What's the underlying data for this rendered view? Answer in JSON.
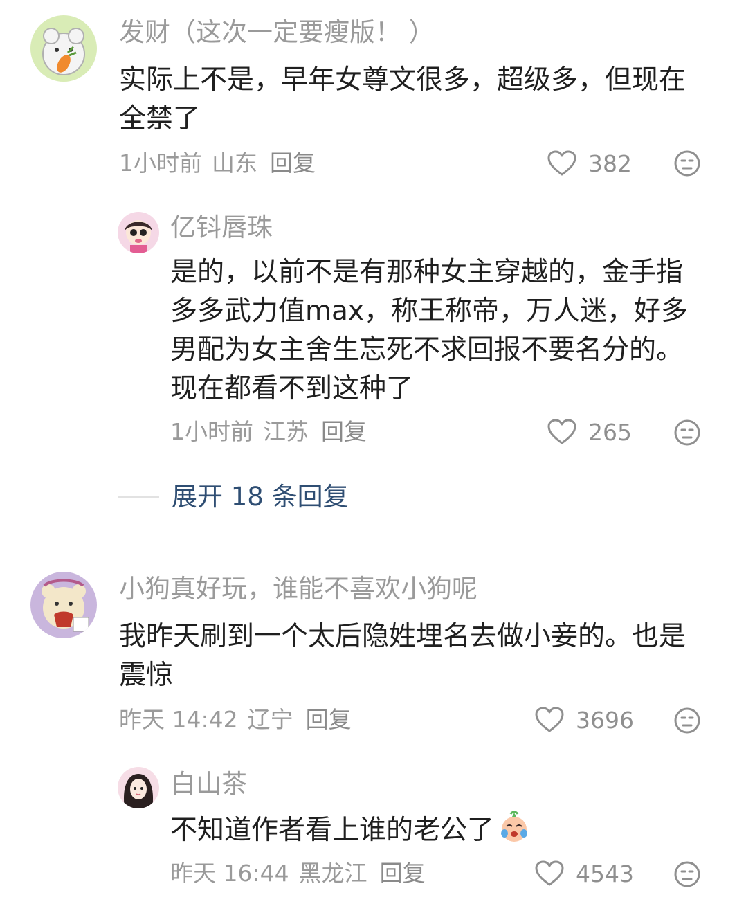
{
  "comments": [
    {
      "user": "发财（这次一定要瘦版！ ）",
      "text": "实际上不是，早年女尊文很多，超级多，但现在全禁了",
      "time": "1小时前",
      "location": "山东",
      "reply_label": "回复",
      "likes": "382"
    },
    {
      "user": "亿钭唇珠",
      "text": "是的，以前不是有那种女主穿越的，金手指多多武力值max，称王称帝，万人迷，好多男配为女主舍生忘死不求回报不要名分的。现在都看不到这种了",
      "time": "1小时前",
      "location": "江苏",
      "reply_label": "回复",
      "likes": "265"
    },
    {
      "user": "小狗真好玩，谁能不喜欢小狗呢",
      "text": "我昨天刷到一个太后隐姓埋名去做小妾的。也是震惊",
      "time": "昨天 14:42",
      "location": "辽宁",
      "reply_label": "回复",
      "likes": "3696"
    },
    {
      "user": "白山茶",
      "text": "不知道作者看上谁的老公了",
      "emoji": "crying-face-emoji",
      "time": "昨天 16:44",
      "location": "黑龙江",
      "reply_label": "回复",
      "likes": "4543"
    }
  ],
  "expand_replies": "展开 18 条回复",
  "icons": {
    "like": "heart-outline-icon",
    "dislike": "unhappy-face-icon"
  },
  "colors": {
    "name": "#9a9a9a",
    "text": "#1f1f1f",
    "meta": "#9a9a9a",
    "expand": "#2f4e73",
    "icon": "#8f8f8f"
  }
}
